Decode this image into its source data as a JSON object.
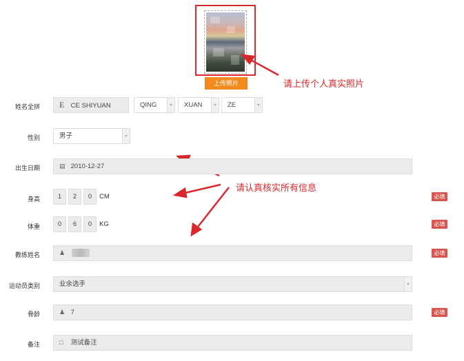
{
  "photo": {
    "upload_label": "上传照片",
    "annotation": "请上传个人真实照片"
  },
  "annotation_verify": "请认真核实所有信息",
  "form": {
    "name": {
      "label": "姓名全拼",
      "icon": "letter-e-icon",
      "icon_glyph": "E",
      "value": "CE SHIYUAN",
      "parts": [
        "QING",
        "XUAN",
        "ZE"
      ]
    },
    "gender": {
      "label": "性别",
      "value": "男子"
    },
    "birth": {
      "label": "出生日期",
      "value": "2010-12-27",
      "icon": "calendar-icon"
    },
    "height": {
      "label": "身高",
      "digits": [
        "1",
        "2",
        "0"
      ],
      "unit": "CM"
    },
    "weight": {
      "label": "体重",
      "digits": [
        "0",
        "6",
        "0"
      ],
      "unit": "KG"
    },
    "coach": {
      "label": "教练姓名",
      "icon": "user-icon"
    },
    "athlete_type": {
      "label": "运动员类别",
      "value": "业余选手"
    },
    "bone_age": {
      "label": "骨龄",
      "value": "7",
      "icon": "user-icon"
    },
    "remark": {
      "label": "备注",
      "value": "测试备注",
      "icon": "bookmark-icon"
    },
    "required_badge": "必填"
  },
  "colors": {
    "accent": "#f28a1d",
    "annotation": "#d9282b",
    "required": "#d9534f"
  }
}
